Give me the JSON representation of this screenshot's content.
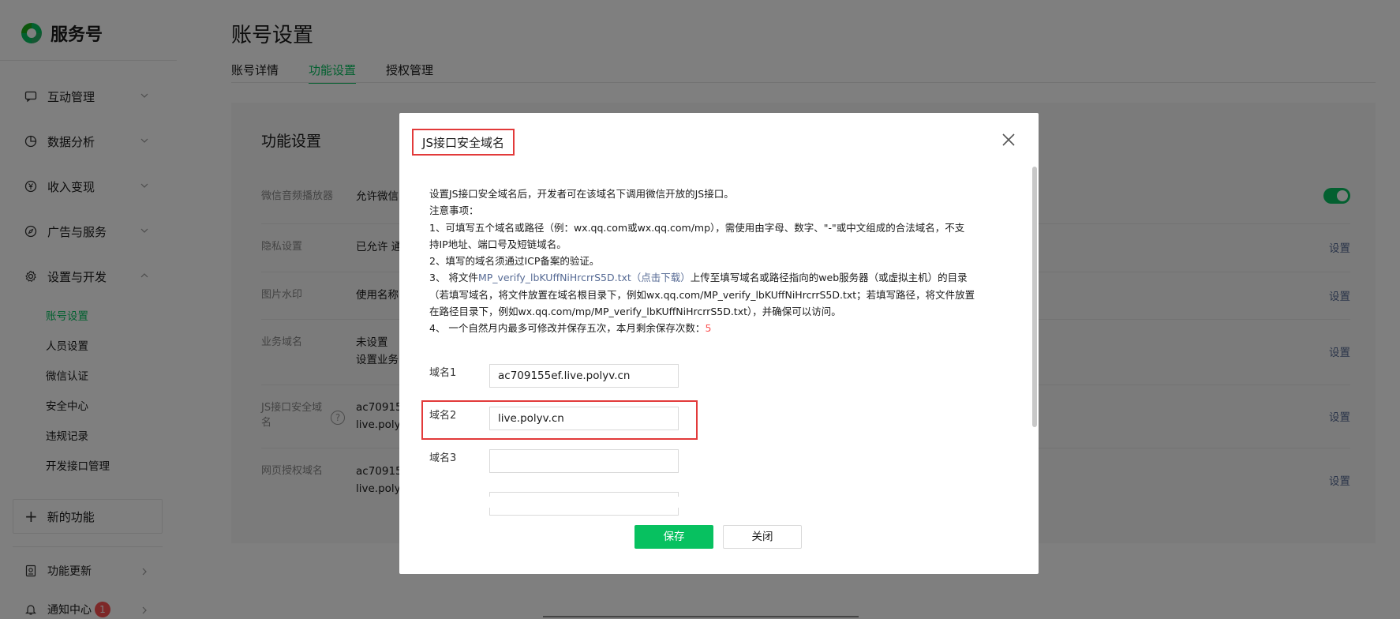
{
  "app": {
    "title": "服务号"
  },
  "sidebar": {
    "items": [
      {
        "label": "互动管理",
        "icon": "chat-icon"
      },
      {
        "label": "数据分析",
        "icon": "pie-chart-icon"
      },
      {
        "label": "收入变现",
        "icon": "yen-icon"
      },
      {
        "label": "广告与服务",
        "icon": "compass-icon"
      },
      {
        "label": "设置与开发",
        "icon": "gear-icon"
      }
    ],
    "subitems": [
      "账号设置",
      "人员设置",
      "微信认证",
      "安全中心",
      "违规记录",
      "开发接口管理"
    ],
    "new_feature": "新的功能",
    "footer": [
      {
        "label": "功能更新",
        "icon": "update-icon"
      },
      {
        "label": "通知中心",
        "icon": "bell-icon",
        "badge": "1"
      }
    ]
  },
  "main": {
    "title": "账号设置",
    "tabs": [
      "账号详情",
      "功能设置",
      "授权管理"
    ],
    "panel_title": "功能设置",
    "rows": [
      {
        "label": "微信音频播放器",
        "value": "允许微信"
      },
      {
        "label": "隐私设置",
        "value": "已允许 通",
        "action": "设置"
      },
      {
        "label": "图片水印",
        "value": "使用名称",
        "action": "设置"
      },
      {
        "label": "业务域名",
        "value": "未设置",
        "value2": "设置业务",
        "action": "设置"
      },
      {
        "label": "JS接口安全域",
        "label2": "名",
        "value": "ac70915",
        "value2": "live.poly",
        "action": "设置"
      },
      {
        "label": "网页授权域名",
        "value": "ac70915",
        "value2": "live.poly",
        "action": "设置"
      }
    ]
  },
  "dialog": {
    "title": "JS接口安全域名",
    "intro": "设置JS接口安全域名后，开发者可在该域名下调用微信开放的JS接口。",
    "notes_title": "注意事项：",
    "note1_a": "1、可填写五个域名或路径（例：wx.qq.com或wx.qq.com/mp），需使用由字母、数字、\"-\"或中文组成的合法域名，不支",
    "note1_b": "持IP地址、端口号及短链域名。",
    "note2": "2、填写的域名须通过ICP备案的验证。",
    "note3_prefix": "3、 将文件",
    "note3_link": "MP_verify_lbKUffNiHrcrrS5D.txt（点击下载）",
    "note3_suffix": "上传至填写域名或路径指向的web服务器（或虚拟主机）的目录",
    "note3_b": "（若填写域名，将文件放置在域名根目录下，例如wx.qq.com/MP_verify_lbKUffNiHrcrrS5D.txt；若填写路径，将文件放置",
    "note3_c": "在路径目录下，例如wx.qq.com/mp/MP_verify_lbKUffNiHrcrrS5D.txt），并确保可以访问。",
    "note4_prefix": "4、 一个自然月内最多可修改并保存五次，本月剩余保存次数：",
    "note4_count": "5",
    "fields": [
      {
        "label": "域名1",
        "value": "ac709155ef.live.polyv.cn"
      },
      {
        "label": "域名2",
        "value": "live.polyv.cn"
      },
      {
        "label": "域名3",
        "value": ""
      }
    ],
    "save_label": "保存",
    "close_label": "关闭"
  },
  "colors": {
    "accent": "#07c160",
    "link": "#576b95",
    "highlight": "#e23a3a"
  }
}
